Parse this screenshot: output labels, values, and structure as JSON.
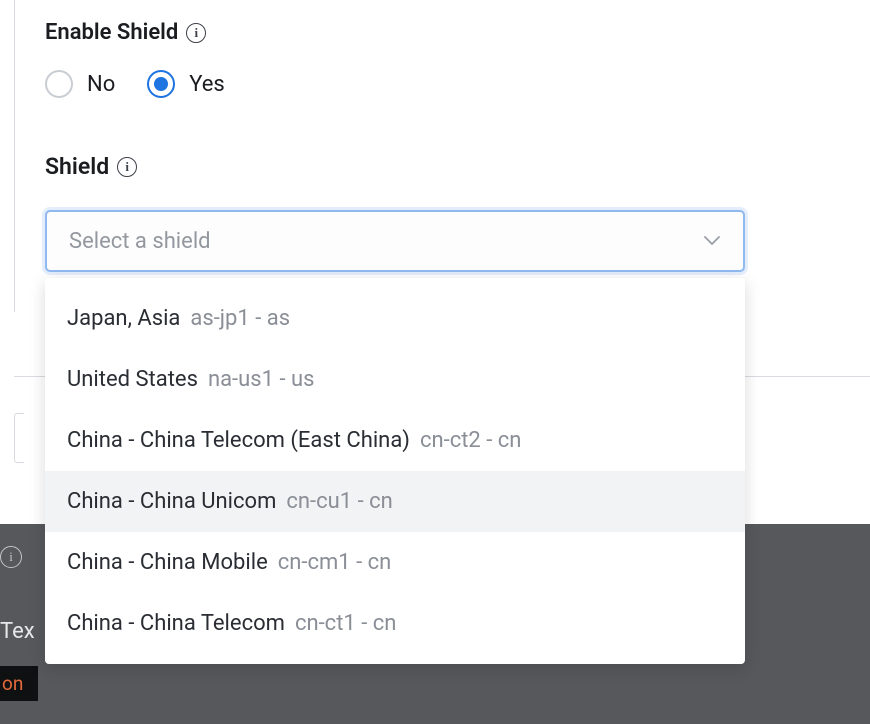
{
  "enableShield": {
    "label": "Enable Shield",
    "options": {
      "no": "No",
      "yes": "Yes"
    },
    "selected": "yes"
  },
  "shield": {
    "label": "Shield",
    "placeholder": "Select a shield",
    "options": [
      {
        "name": "Japan, Asia",
        "code": "as-jp1 - as",
        "highlighted": false
      },
      {
        "name": "United States",
        "code": "na-us1 - us",
        "highlighted": false
      },
      {
        "name": "China - China Telecom (East China)",
        "code": "cn-ct2 - cn",
        "highlighted": false
      },
      {
        "name": "China - China Unicom",
        "code": "cn-cu1 - cn",
        "highlighted": true
      },
      {
        "name": "China - China Mobile",
        "code": "cn-cm1 - cn",
        "highlighted": false
      },
      {
        "name": "China - China Telecom",
        "code": "cn-ct1 - cn",
        "highlighted": false
      }
    ]
  },
  "background": {
    "texLabel": "Tex",
    "orangeLabel": "on"
  }
}
